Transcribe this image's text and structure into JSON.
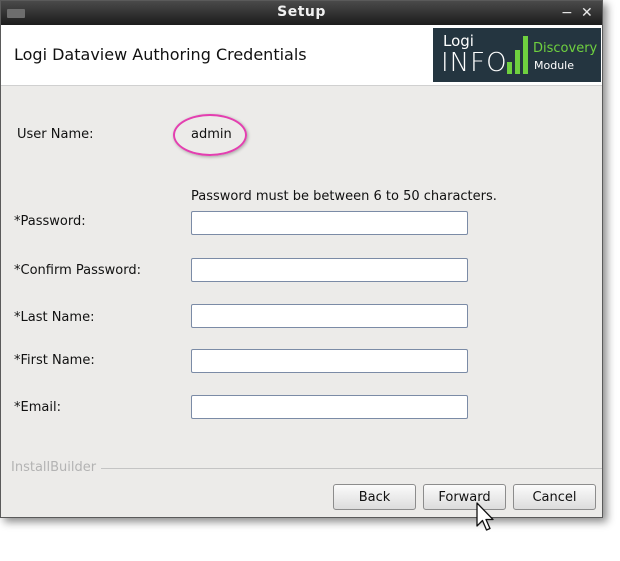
{
  "window": {
    "title": "Setup",
    "minimize_glyph": "−",
    "close_glyph": "✕"
  },
  "header": {
    "title": "Logi Dataview Authoring Credentials",
    "logo": {
      "line1": "Logi",
      "line2": "INFO",
      "tag1": "Discovery",
      "tag2": "Module"
    }
  },
  "form": {
    "username_label": "User Name:",
    "username_value": "admin",
    "password_hint": "Password must be between 6 to 50 characters.",
    "fields": [
      {
        "label": "*Password:",
        "value": ""
      },
      {
        "label": "*Confirm Password:",
        "value": ""
      },
      {
        "label": "*Last Name:",
        "value": ""
      },
      {
        "label": "*First Name:",
        "value": ""
      },
      {
        "label": "*Email:",
        "value": ""
      }
    ]
  },
  "footer": {
    "brand": "InstallBuilder",
    "back_label": "Back",
    "forward_label": "Forward",
    "cancel_label": "Cancel"
  },
  "colors": {
    "highlight": "#e33fb0",
    "logo_bg": "#243540",
    "logo_accent": "#6fd13f",
    "titlebar": "#2b2b2b"
  }
}
